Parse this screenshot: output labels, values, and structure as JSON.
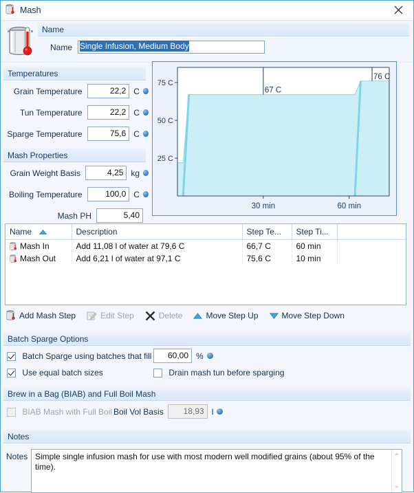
{
  "window": {
    "title": "Mash",
    "title_icon": "mash-tun-icon",
    "close_label": "✕"
  },
  "header": {
    "band_label": "Name",
    "name_label": "Name",
    "name_value": "Single Infusion, Medium Body"
  },
  "temperatures": {
    "section_title": "Temperatures",
    "fields": [
      {
        "label": "Grain Temperature",
        "value": "22,2",
        "unit": "C"
      },
      {
        "label": "Tun Temperature",
        "value": "22,2",
        "unit": "C"
      },
      {
        "label": "Sparge Temperature",
        "value": "75,6",
        "unit": "C"
      }
    ]
  },
  "mash_properties": {
    "section_title": "Mash Properties",
    "fields": [
      {
        "label": "Grain Weight Basis",
        "value": "4,25",
        "unit": "kg"
      },
      {
        "label": "Boiling Temperature",
        "value": "100,0",
        "unit": "C"
      },
      {
        "label": "Mash PH",
        "value": "5,40",
        "unit": ""
      }
    ]
  },
  "chart_data": {
    "type": "area",
    "title": "",
    "xlabel": "",
    "ylabel": "",
    "x": [
      0,
      2,
      4,
      62,
      64,
      74
    ],
    "values": [
      22,
      22,
      67,
      67,
      76,
      76
    ],
    "ylim": [
      0,
      85
    ],
    "xlim": [
      0,
      74
    ],
    "yticks": [
      25,
      50,
      75
    ],
    "ytick_labels": [
      "25 C",
      "50 C",
      "75 C"
    ],
    "xticks": [
      30,
      60
    ],
    "xtick_labels": [
      "30 min",
      "60 min"
    ],
    "annotations": [
      {
        "label": "67 C",
        "x": 30,
        "y": 67
      },
      {
        "label": "76 C",
        "x": 68,
        "y": 76
      }
    ],
    "grid": false,
    "legend": "none",
    "fill_color": "#cbeef7",
    "line_color": "#7fd4e8"
  },
  "steps_table": {
    "columns": [
      "Name",
      "Description",
      "Step Te...",
      "Step Ti...",
      ""
    ],
    "sort_column": "Name",
    "sort_direction": "ascending",
    "rows": [
      {
        "name": "Mash In",
        "description": "Add 11,08 l of water at 79,6 C",
        "step_temp": "66,7 C",
        "step_time": "60 min",
        "extra": ""
      },
      {
        "name": "Mash Out",
        "description": "Add 6,21 l of water at 97,1 C",
        "step_temp": "75,6 C",
        "step_time": "10 min",
        "extra": ""
      }
    ]
  },
  "toolbar": {
    "buttons": [
      {
        "label": "Add Mash Step",
        "icon": "mash-tun-icon",
        "enabled": true
      },
      {
        "label": "Edit Step",
        "icon": "edit-pencil-icon",
        "enabled": false
      },
      {
        "label": "Delete",
        "icon": "delete-x-icon",
        "enabled": false
      },
      {
        "label": "Move Step Up",
        "icon": "triangle-up-icon",
        "enabled": true
      },
      {
        "label": "Move Step Down",
        "icon": "triangle-down-icon",
        "enabled": true
      }
    ]
  },
  "batch_sparge": {
    "section_title": "Batch Sparge Options",
    "fill_checkbox_label": "Batch Sparge using batches that fill",
    "fill_checked": true,
    "fill_value": "60,00",
    "fill_unit": "%",
    "equal_sizes_label": "Use equal batch sizes",
    "equal_sizes_checked": true,
    "drain_label": "Drain mash tun before sparging",
    "drain_checked": false
  },
  "biab": {
    "section_title": "Brew in a Bag (BIAB) and Full Boil Mash",
    "checkbox_label": "BIAB Mash with Full Boil",
    "checked": false,
    "enabled": false,
    "boil_vol_label": "Boil Vol Basis",
    "boil_vol_value": "18,93",
    "boil_vol_unit": "l"
  },
  "notes": {
    "section_title": "Notes",
    "field_label": "Notes",
    "value": "Simple single infusion mash for use with most modern well modified grains (about 95% of the time).",
    "scroll_up": "⌃",
    "scroll_down": "⌄"
  }
}
